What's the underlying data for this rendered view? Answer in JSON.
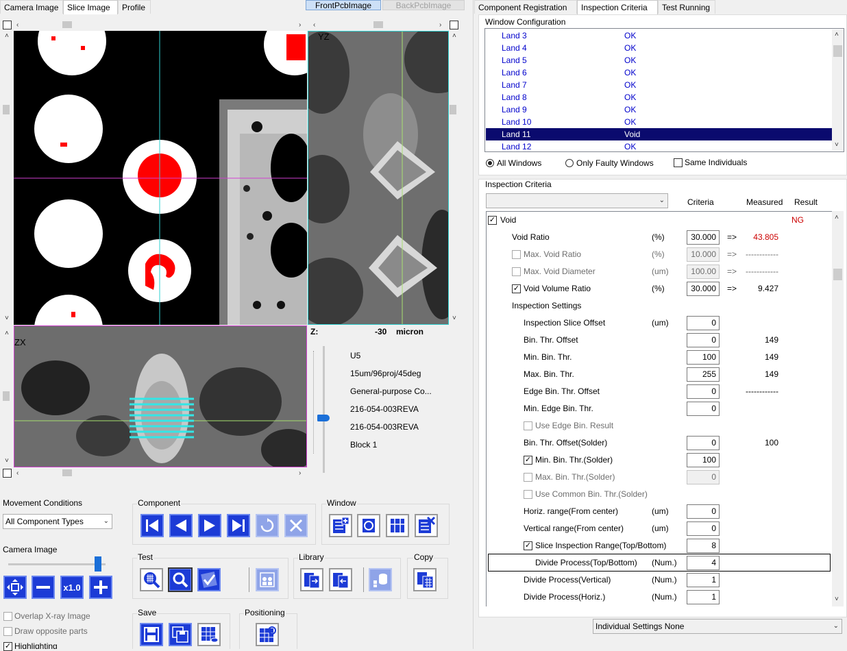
{
  "left_tabs": [
    "Camera Image",
    "Slice Image",
    "Profile"
  ],
  "image_tabs": [
    "FrontPcbImage",
    "BackPcbImage"
  ],
  "right_tabs": [
    "Component Registration",
    "Inspection Criteria",
    "Test Running"
  ],
  "views": {
    "yz_label": "YZ",
    "zx_label": "ZX",
    "z_label": "Z:",
    "z_value": "-30",
    "z_unit": "micron",
    "z_level": 0.6
  },
  "info": [
    "U5",
    "15um/96proj/45deg",
    "General-purpose Co...",
    "216-054-003REVA",
    "216-054-003REVA",
    "Block 1"
  ],
  "movement": {
    "title": "Movement Conditions",
    "selected": "All Component Types"
  },
  "camera_image": {
    "title": "Camera Image",
    "level": 0.95,
    "zoom_label": "x1.0"
  },
  "overlays": {
    "overlay_xray": "Overlap X-ray Image",
    "draw_opposite": "Draw opposite parts",
    "highlighting": "Highlighting"
  },
  "groups": {
    "component": "Component",
    "window": "Window",
    "test": "Test",
    "library": "Library",
    "copy": "Copy",
    "save": "Save",
    "positioning": "Positioning"
  },
  "window_config": {
    "title": "Window Configuration",
    "rows": [
      {
        "name": "Land 3",
        "status": "OK"
      },
      {
        "name": "Land 4",
        "status": "OK"
      },
      {
        "name": "Land 5",
        "status": "OK"
      },
      {
        "name": "Land 6",
        "status": "OK"
      },
      {
        "name": "Land 7",
        "status": "OK"
      },
      {
        "name": "Land 8",
        "status": "OK"
      },
      {
        "name": "Land 9",
        "status": "OK"
      },
      {
        "name": "Land 10",
        "status": "OK"
      },
      {
        "name": "Land 11",
        "status": "Void"
      },
      {
        "name": "Land 12",
        "status": "OK"
      }
    ],
    "selected_index": 8,
    "all_windows": "All Windows",
    "only_faulty": "Only Faulty Windows",
    "same_individuals": "Same Individuals"
  },
  "criteria": {
    "title": "Inspection Criteria",
    "col_criteria": "Criteria",
    "col_measured": "Measured",
    "col_result": "Result",
    "void_label": "Void",
    "void_result": "NG",
    "arrow": "=>",
    "rows": [
      {
        "label": "Void Ratio",
        "unit": "(%)",
        "value": "30.000",
        "measured": "43.805"
      },
      {
        "label": "Max. Void Ratio",
        "unit": "(%)",
        "value": "10.000",
        "measured": "------------"
      },
      {
        "label": "Max. Void Diameter",
        "unit": "(um)",
        "value": "100.00",
        "measured": "------------"
      },
      {
        "label": "Void Volume Ratio",
        "unit": "(%)",
        "value": "30.000",
        "measured": "9.427"
      },
      {
        "label": "Inspection Settings"
      },
      {
        "label": "Inspection Slice Offset",
        "unit": "(um)",
        "value": "0"
      },
      {
        "label": "Bin. Thr. Offset",
        "value": "0",
        "measured": "149"
      },
      {
        "label": "Min. Bin. Thr.",
        "value": "100",
        "measured": "149"
      },
      {
        "label": "Max. Bin. Thr.",
        "value": "255",
        "measured": "149"
      },
      {
        "label": "Edge Bin. Thr. Offset",
        "value": "0",
        "measured": "------------"
      },
      {
        "label": "Min. Edge Bin. Thr.",
        "value": "0"
      },
      {
        "label": "Use Edge Bin. Result"
      },
      {
        "label": "Bin. Thr. Offset(Solder)",
        "value": "0",
        "measured": "100"
      },
      {
        "label": "Min. Bin. Thr.(Solder)",
        "value": "100"
      },
      {
        "label": "Max. Bin. Thr.(Solder)",
        "value": "0"
      },
      {
        "label": "Use Common Bin. Thr.(Solder)"
      },
      {
        "label": "Horiz. range(From center)",
        "unit": "(um)",
        "value": "0"
      },
      {
        "label": "Vertical range(From center)",
        "unit": "(um)",
        "value": "0"
      },
      {
        "label": "Slice Inspection Range(Top/Bottom)",
        "value": "8"
      },
      {
        "label": "Divide Process(Top/Bottom)",
        "unit": "(Num.)",
        "value": "4"
      },
      {
        "label": "Divide Process(Vertical)",
        "unit": "(Num.)",
        "value": "1"
      },
      {
        "label": "Divide Process(Horiz.)",
        "unit": "(Num.)",
        "value": "1"
      }
    ]
  },
  "individual_settings": "Individual Settings None",
  "colors": {
    "accent_red": "#cc0000",
    "list_text": "#0000cc",
    "selection": "#0a0a6e",
    "button_blue": "#1c3bd6"
  }
}
